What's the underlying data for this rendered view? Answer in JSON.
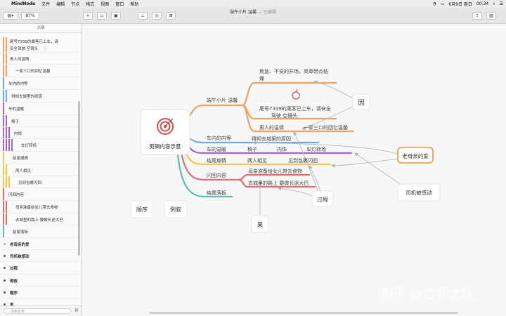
{
  "menubar": {
    "app": "MindNode",
    "menus": [
      "文件",
      "编辑",
      "节点",
      "格式",
      "视图",
      "窗口",
      "帮助"
    ],
    "date": "6月9日 周日",
    "time": "00:34"
  },
  "toolbar": {
    "zoom": "87%",
    "doc_title": "端午小片 温馨",
    "doc_status": "— 已编辑"
  },
  "sidebar": {
    "header": "大纲",
    "items": [
      "尾号7339的乘客已上车，请",
      "安全驾驶 空镜头",
      "男人的温情",
      "一家三口的回忆温馨",
      "车内的内等",
      "得知去城里的原因",
      "车的温暖",
      "椅子",
      "内饰",
      "车灯转场",
      "结尾煽情",
      "两人相见",
      "见到包裹闪回",
      "闪回内容",
      "母亲准备给女儿带去食物",
      "去城里的路上 要做长途大巴",
      "结尾落板",
      "老母亲的爱",
      "司机被感动",
      "过程",
      "倒叙",
      "顺序",
      "果"
    ],
    "search_placeholder": "搜索名称"
  },
  "mindmap": {
    "root": "剪辑内容示意",
    "branches": {
      "b1": "端午小片 温馨",
      "b2": "车内的内等",
      "b3": "车的温暖",
      "b4": "结尾煽情",
      "b5": "闪回内容",
      "b6": "结尾落板"
    },
    "leaves": {
      "l1a": "焦急、不安的开场，简单带点结",
      "l1b": "燥",
      "l2a": "尾号7339的乘客已上车，请安全",
      "l2b": "驾驶 空镜头",
      "l3": "男人的温情",
      "l4": "一家三口的回忆温馨",
      "l5": "得知去城里的原因",
      "l6": "椅子",
      "l7": "内饰",
      "l8": "车灯转场",
      "l9": "两人相见",
      "l10": "见到包裹闪回",
      "l11": "母亲准备给女儿带去食物",
      "l12": "去城里的路上 要做长途大巴"
    },
    "floating": {
      "yin": "因",
      "love": "老母亲的爱",
      "moved": "司机被感动",
      "process": "过程",
      "result": "果",
      "order": "顺序",
      "reverse": "倒叙"
    }
  },
  "watermark": "知乎 @信仰之跃",
  "colors": {
    "orange": "#f0a060",
    "blue": "#6fa8e0",
    "purple": "#a866c8",
    "yellow": "#f2c84a",
    "red": "#e07070",
    "teal": "#5bbfb0",
    "accent_border": "#f0a050"
  }
}
